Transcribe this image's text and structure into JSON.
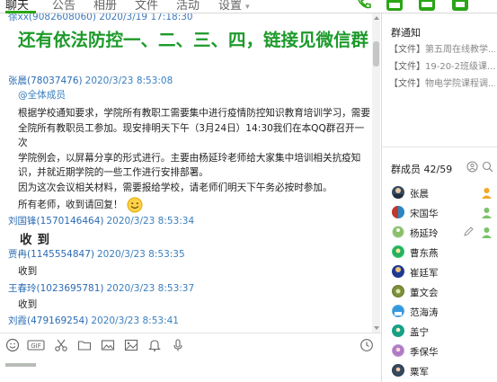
{
  "tabs": [
    {
      "label": "聊天",
      "active": true
    },
    {
      "label": "公告"
    },
    {
      "label": "相册"
    },
    {
      "label": "文件"
    },
    {
      "label": "活动"
    },
    {
      "label": "设置"
    }
  ],
  "top_icons": [
    "phone-icon",
    "video-call-icon",
    "screen-share-icon",
    "app-icon"
  ],
  "chat": {
    "partial_header": "徐xx(9082608060) 2020/3/19 17:18:30",
    "title_message": "还有依法防控一、二、三、四，链接见微信群",
    "messages": [
      {
        "name": "张晨",
        "qq": "(78037476)",
        "time": "2020/3/23 8:53:08",
        "mention": "@全体成员",
        "lines": [
          "根据学校通知要求，学院所有教职工需要集中进行疫情防控知识教育培训学习，需要",
          "全院所有教职员工参加。现安排明天下午（3月24日）14:30我们在本QQ群召开一次",
          "学院例会，以屏幕分享的形式进行。主要由杨延玲老师给大家集中培训相关抗疫知",
          "识，并就近期学院的一些工作进行安排部署。",
          "因为这次会议相关材料，需要报给学校，请老师们明天下午务必按时参加。",
          "所有老师，收到请回复！"
        ]
      },
      {
        "name": "刘国锋",
        "qq": "(1570146464)",
        "time": "2020/3/23 8:53:34",
        "text": "收到"
      },
      {
        "name": "贾冉",
        "qq": "(1145554847)",
        "time": "2020/3/23 8:53:35",
        "text": "收到"
      },
      {
        "name": "王春玲",
        "qq": "(1023695781)",
        "time": "2020/3/23 8:53:37",
        "text": "收到"
      },
      {
        "name": "刘霞",
        "qq": "(479169254)",
        "time": "2020/3/23 8:53:41",
        "text": ""
      }
    ]
  },
  "toolbar": [
    "emoji-icon",
    "gif-icon",
    "scissors-icon",
    "folder-icon",
    "image-folder-icon",
    "picture-icon",
    "bell-icon",
    "mic-icon",
    "history-clock-icon"
  ],
  "notice": {
    "title": "群通知",
    "items": [
      {
        "tag": "【文件】",
        "text": "第五周在线教学..."
      },
      {
        "tag": "【文件】",
        "text": "19-20-2班级课..."
      },
      {
        "tag": "【文件】",
        "text": "物电学院课程调..."
      }
    ]
  },
  "members": {
    "title": "群成员",
    "count": "42/59",
    "list": [
      {
        "name": "张晨",
        "role": "owner"
      },
      {
        "name": "宋国华",
        "role": "admin"
      },
      {
        "name": "杨延玲",
        "role": "admin"
      },
      {
        "name": "曹东燕",
        "role": ""
      },
      {
        "name": "崔廷军",
        "role": ""
      },
      {
        "name": "董文会",
        "role": ""
      },
      {
        "name": "范海涛",
        "role": ""
      },
      {
        "name": "盖宁",
        "role": ""
      },
      {
        "name": "季保华",
        "role": ""
      },
      {
        "name": "粟军",
        "role": ""
      }
    ]
  },
  "colors": {
    "accent": "#2aa515",
    "title_green": "#1d9a2b",
    "link_blue": "#2a6bb3"
  }
}
